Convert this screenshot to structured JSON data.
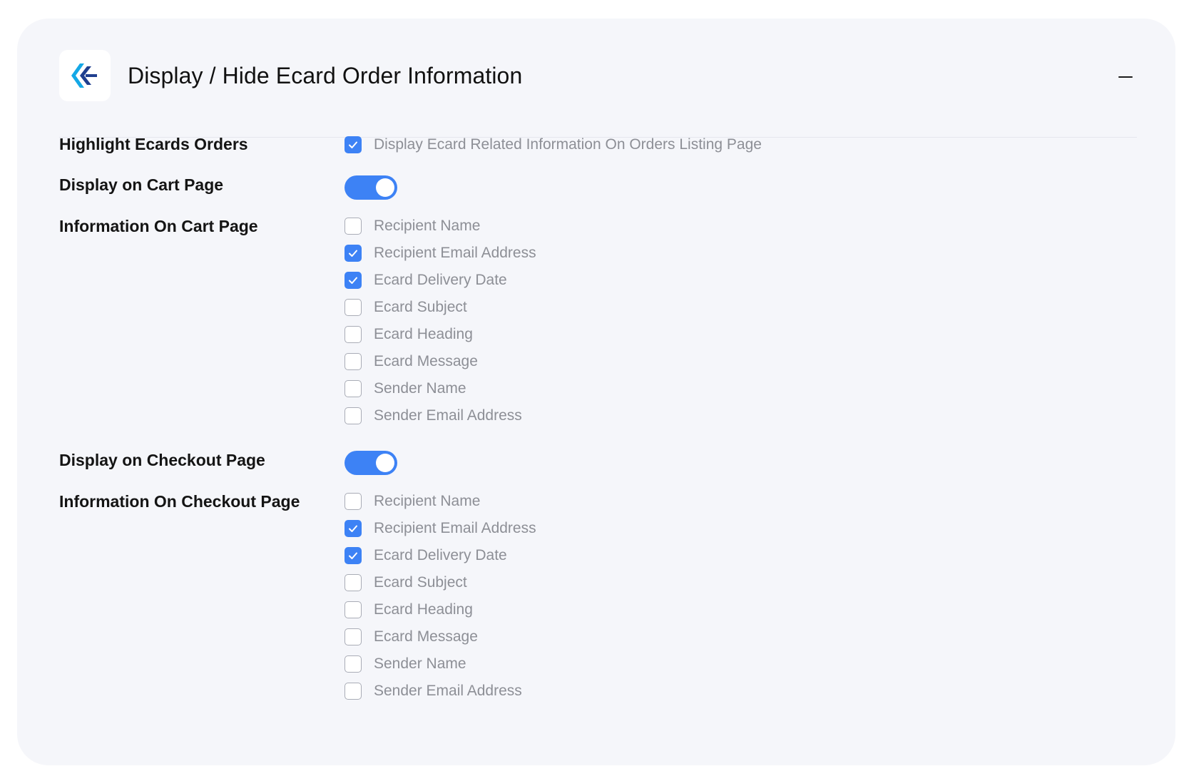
{
  "colors": {
    "accent": "#3d82f5",
    "panel_bg": "#f5f6fa",
    "logo_blue_dark": "#1f3f8f",
    "logo_cyan": "#14a8e6"
  },
  "section": {
    "title": "Display / Hide Ecard Order Information",
    "collapse_icon": "minus-icon",
    "logo_icon": "brand-logo-icon"
  },
  "highlight": {
    "label": "Highlight Ecards Orders",
    "option": {
      "label": "Display Ecard Related Information On Orders Listing Page",
      "checked": true
    }
  },
  "cart": {
    "toggle_label": "Display on Cart Page",
    "toggle_on": true,
    "info_label": "Information On Cart Page",
    "options": [
      {
        "label": "Recipient Name",
        "checked": false
      },
      {
        "label": "Recipient Email Address",
        "checked": true
      },
      {
        "label": "Ecard Delivery Date",
        "checked": true
      },
      {
        "label": "Ecard Subject",
        "checked": false
      },
      {
        "label": "Ecard Heading",
        "checked": false
      },
      {
        "label": "Ecard Message",
        "checked": false
      },
      {
        "label": "Sender Name",
        "checked": false
      },
      {
        "label": "Sender Email Address",
        "checked": false
      }
    ]
  },
  "checkout": {
    "toggle_label": "Display on Checkout Page",
    "toggle_on": true,
    "info_label": "Information On Checkout Page",
    "options": [
      {
        "label": "Recipient Name",
        "checked": false
      },
      {
        "label": "Recipient Email Address",
        "checked": true
      },
      {
        "label": "Ecard Delivery Date",
        "checked": true
      },
      {
        "label": "Ecard Subject",
        "checked": false
      },
      {
        "label": "Ecard Heading",
        "checked": false
      },
      {
        "label": "Ecard Message",
        "checked": false
      },
      {
        "label": "Sender Name",
        "checked": false
      },
      {
        "label": "Sender Email Address",
        "checked": false
      }
    ]
  }
}
